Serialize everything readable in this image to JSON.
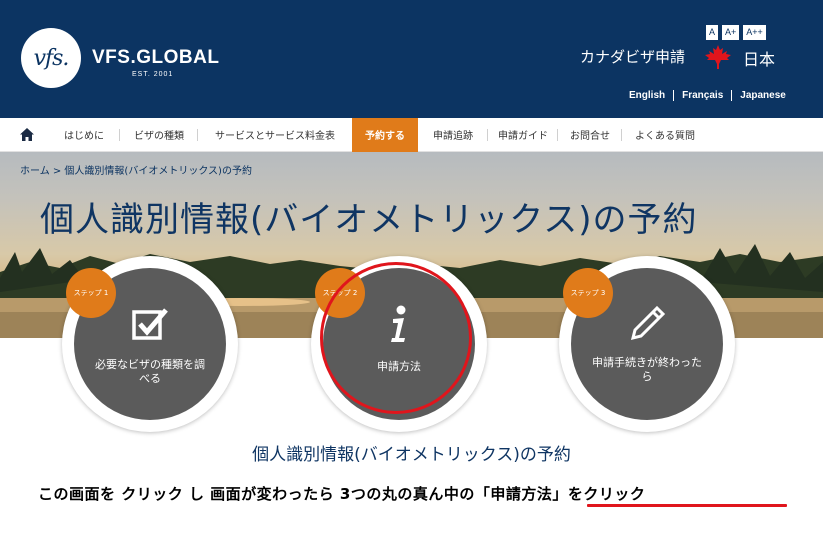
{
  "header": {
    "logo_text": "VFS.GLOBAL",
    "logo_est": "EST. 2001",
    "font_sizes": [
      "A",
      "A+",
      "A++"
    ],
    "country_title": "カナダビザ申請",
    "country_name": "日本",
    "languages": [
      "English",
      "Français",
      "Japanese"
    ]
  },
  "nav": {
    "items": [
      "はじめに",
      "ビザの種類",
      "サービスとサービス料金表",
      "予約する",
      "申請追跡",
      "申請ガイド",
      "お問合せ",
      "よくある質問"
    ],
    "active_index": 3
  },
  "breadcrumb": "ホーム > 個人識別情報(バイオメトリックス)の予約",
  "hero_title": "個人識別情報(バイオメトリックス)の予約",
  "steps": [
    {
      "badge": "ステップ 1",
      "label": "必要なビザの種類を調べる",
      "icon": "checkbox-icon"
    },
    {
      "badge": "ステップ 2",
      "label": "申請方法",
      "icon": "info-icon"
    },
    {
      "badge": "ステップ 3",
      "label": "申請手続きが終わったら",
      "icon": "pencil-icon"
    }
  ],
  "section_title": "個人識別情報(バイオメトリックス)の予約",
  "instruction": "この画面を クリック し 画面が変わったら 3つの丸の真ん中の「申請方法」をクリック",
  "colors": {
    "header_bg": "#0c3462",
    "accent_orange": "#e07b1a",
    "step_circle": "#5b5b5b",
    "highlight_red": "#e0151c",
    "title_blue": "#0f3563"
  }
}
